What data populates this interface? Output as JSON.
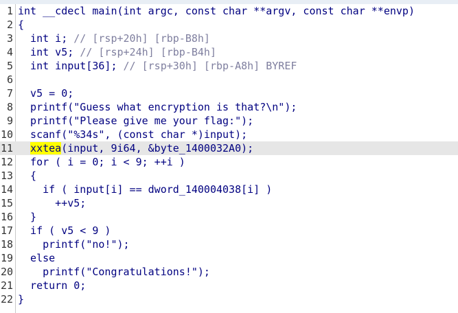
{
  "tabs": [
    "",
    "",
    "",
    ""
  ],
  "lines": [
    {
      "n": "1",
      "t": "int __cdecl main(int argc, const char **argv, const char **envp)"
    },
    {
      "n": "2",
      "t": "{"
    },
    {
      "n": "3",
      "t": "  int i; // [rsp+20h] [rbp-B8h]"
    },
    {
      "n": "4",
      "t": "  int v5; // [rsp+24h] [rbp-B4h]"
    },
    {
      "n": "5",
      "t": "  int input[36]; // [rsp+30h] [rbp-A8h] BYREF"
    },
    {
      "n": "6",
      "t": ""
    },
    {
      "n": "7",
      "t": "  v5 = 0;"
    },
    {
      "n": "8",
      "t": "  printf(\"Guess what encryption is that?\\n\");"
    },
    {
      "n": "9",
      "t": "  printf(\"Please give me your flag:\");"
    },
    {
      "n": "10",
      "t": "  scanf(\"%34s\", (const char *)input);"
    },
    {
      "n": "11",
      "t": "  xxtea(input, 9i64, &byte_1400032A0);"
    },
    {
      "n": "12",
      "t": "  for ( i = 0; i < 9; ++i )"
    },
    {
      "n": "13",
      "t": "  {"
    },
    {
      "n": "14",
      "t": "    if ( input[i] == dword_140004038[i] )"
    },
    {
      "n": "15",
      "t": "      ++v5;"
    },
    {
      "n": "16",
      "t": "  }"
    },
    {
      "n": "17",
      "t": "  if ( v5 < 9 )"
    },
    {
      "n": "18",
      "t": "    printf(\"no!\");"
    },
    {
      "n": "19",
      "t": "  else"
    },
    {
      "n": "20",
      "t": "    printf(\"Congratulations!\");"
    },
    {
      "n": "21",
      "t": "  return 0;"
    },
    {
      "n": "22",
      "t": "}"
    }
  ],
  "highlight_line": "11",
  "highlight_word": "xxtea",
  "colors": {
    "code": "#000080",
    "comment": "#7f7f9f",
    "highlight_line": "#e6e6e6",
    "highlight_word": "#ffff00"
  }
}
